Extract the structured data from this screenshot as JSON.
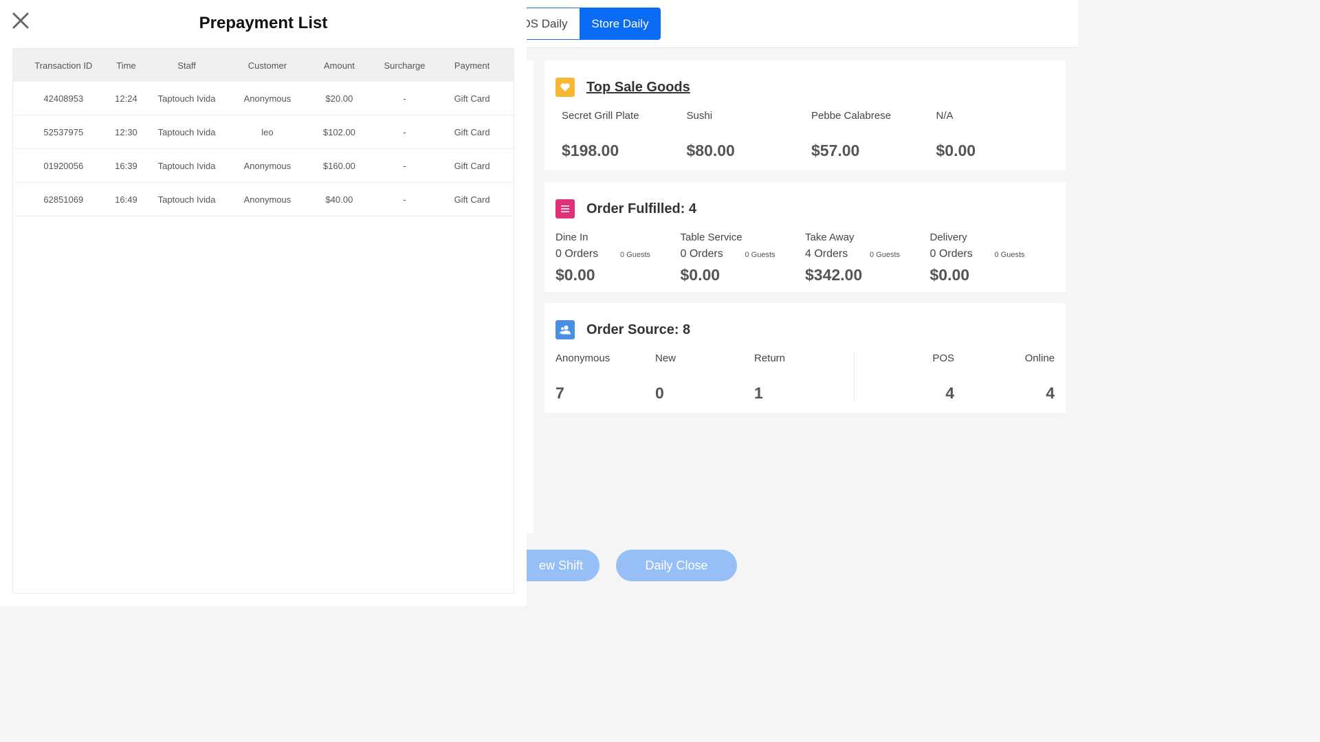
{
  "tabs": {
    "pos_daily": "OS Daily",
    "store_daily": "Store Daily"
  },
  "top_sale": {
    "title": "Top Sale Goods",
    "items": [
      {
        "name": "Secret Grill Plate",
        "amount": "$198.00"
      },
      {
        "name": "Sushi",
        "amount": "$80.00"
      },
      {
        "name": "Pebbe Calabrese",
        "amount": "$57.00"
      },
      {
        "name": "N/A",
        "amount": "$0.00"
      }
    ]
  },
  "order_fulfilled": {
    "title": "Order Fulfilled: 4",
    "items": [
      {
        "name": "Dine In",
        "orders": "0 Orders",
        "guests": "0 Guests",
        "amount": "$0.00"
      },
      {
        "name": "Table Service",
        "orders": "0 Orders",
        "guests": "0 Guests",
        "amount": "$0.00"
      },
      {
        "name": "Take Away",
        "orders": "4 Orders",
        "guests": "0 Guests",
        "amount": "$342.00"
      },
      {
        "name": "Delivery",
        "orders": "0 Orders",
        "guests": "0 Guests",
        "amount": "$0.00"
      }
    ]
  },
  "order_source": {
    "title": "Order Source: 8",
    "items": [
      {
        "label": "Anonymous",
        "value": "7"
      },
      {
        "label": "New",
        "value": "0"
      },
      {
        "label": "Return",
        "value": "1"
      },
      {
        "label": "POS",
        "value": "4"
      },
      {
        "label": "Online",
        "value": "4"
      }
    ]
  },
  "buttons": {
    "new_shift": "ew Shift",
    "daily_close": "Daily Close"
  },
  "modal": {
    "title": "Prepayment List",
    "columns": [
      "Transaction ID",
      "Time",
      "Staff",
      "Customer",
      "Amount",
      "Surcharge",
      "Payment"
    ],
    "rows": [
      [
        "42408953",
        "12:24",
        "Taptouch Ivida",
        "Anonymous",
        "$20.00",
        "-",
        "Gift Card"
      ],
      [
        "52537975",
        "12:30",
        "Taptouch Ivida",
        "leo",
        "$102.00",
        "-",
        "Gift Card"
      ],
      [
        "01920056",
        "16:39",
        "Taptouch Ivida",
        "Anonymous",
        "$160.00",
        "-",
        "Gift Card"
      ],
      [
        "62851069",
        "16:49",
        "Taptouch Ivida",
        "Anonymous",
        "$40.00",
        "-",
        "Gift Card"
      ]
    ]
  },
  "colors": {
    "accent": "#0a6cf5",
    "top_sale_badge": "#f7b733",
    "fulfilled_badge": "#e0307a",
    "source_badge": "#4a90e2",
    "pill": "#96bff8"
  },
  "icons": {
    "close": "close-icon",
    "top_sale": "heart-icon",
    "fulfilled": "list-icon",
    "source": "users-icon"
  }
}
